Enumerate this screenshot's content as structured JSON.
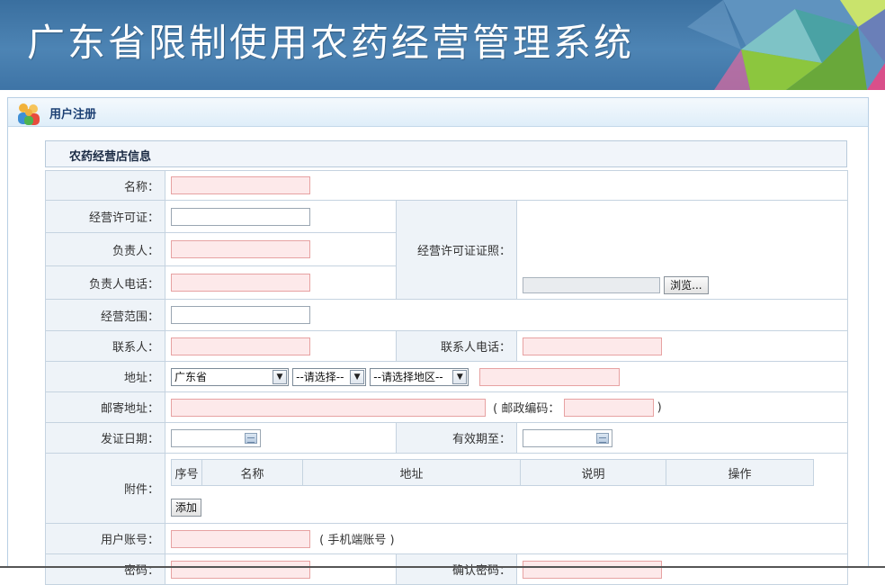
{
  "banner": {
    "title": "广东省限制使用农药经营管理系统"
  },
  "panel": {
    "title": "用户注册"
  },
  "section": {
    "title": "农药经营店信息"
  },
  "form": {
    "name_label": "名称：",
    "license_label": "经营许可证：",
    "license_photo_label": "经营许可证证照：",
    "owner_label": "负责人：",
    "owner_phone_label": "负责人电话：",
    "browse_label": "浏览...",
    "scope_label": "经营范围：",
    "contact_label": "联系人：",
    "contact_phone_label": "联系人电话：",
    "address_label": "地址：",
    "province_value": "广东省",
    "city_value": "--请选择--",
    "district_value": "--请选择地区--",
    "mail_address_label": "邮寄地址：",
    "postcode_open": "( 邮政编码：",
    "postcode_close": ")",
    "issue_date_label": "发证日期：",
    "valid_until_label": "有效期至：",
    "attachment_label": "附件：",
    "attachment_columns": [
      "序号",
      "名称",
      "地址",
      "说明",
      "操作"
    ],
    "add_button": "添加",
    "account_label": "用户账号：",
    "account_hint": "( 手机端账号 )",
    "password_label": "密码：",
    "confirm_password_label": "确认密码："
  },
  "colors": {
    "banner": "#4d84b4",
    "required_field_bg": "#fde9ea",
    "required_field_border": "#e7a2a2",
    "label_cell_bg": "#eef3f8"
  }
}
